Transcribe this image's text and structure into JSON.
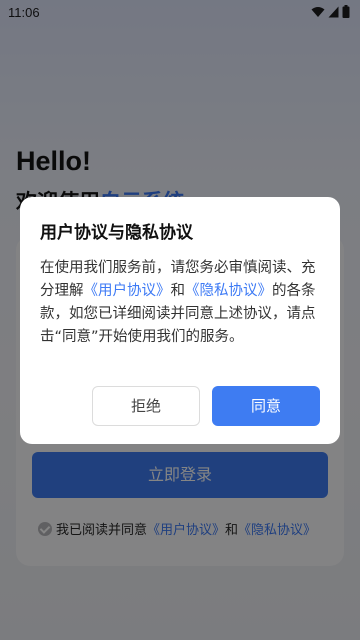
{
  "status_bar": {
    "time": "11:06",
    "icons": [
      "wifi-icon",
      "signal-icon",
      "battery-icon"
    ]
  },
  "page": {
    "hello": "Hello!",
    "welcome_prefix": "欢迎使用",
    "welcome_accent": "白云系统",
    "login_button": "立即登录",
    "agree_text": "我已阅读并同意",
    "agree_link_user": "《用户协议》",
    "agree_and": "和",
    "agree_link_privacy": "《隐私协议》",
    "agree_checked": true
  },
  "dialog": {
    "title": "用户协议与隐私协议",
    "body_1": "在使用我们服务前，请您务必审慎阅读、充分理解",
    "link_user": "《用户协议》",
    "body_and": "和",
    "link_privacy": "《隐私协议》",
    "body_2": "的各条款，如您已详细阅读并同意上述协议，请点击“同意”开始使用我们的服务。",
    "reject_label": "拒绝",
    "agree_label": "同意"
  },
  "colors": {
    "accent": "#3e7cf2",
    "link": "#3d7af5",
    "overlay": "rgba(0,0,0,0.48)"
  }
}
